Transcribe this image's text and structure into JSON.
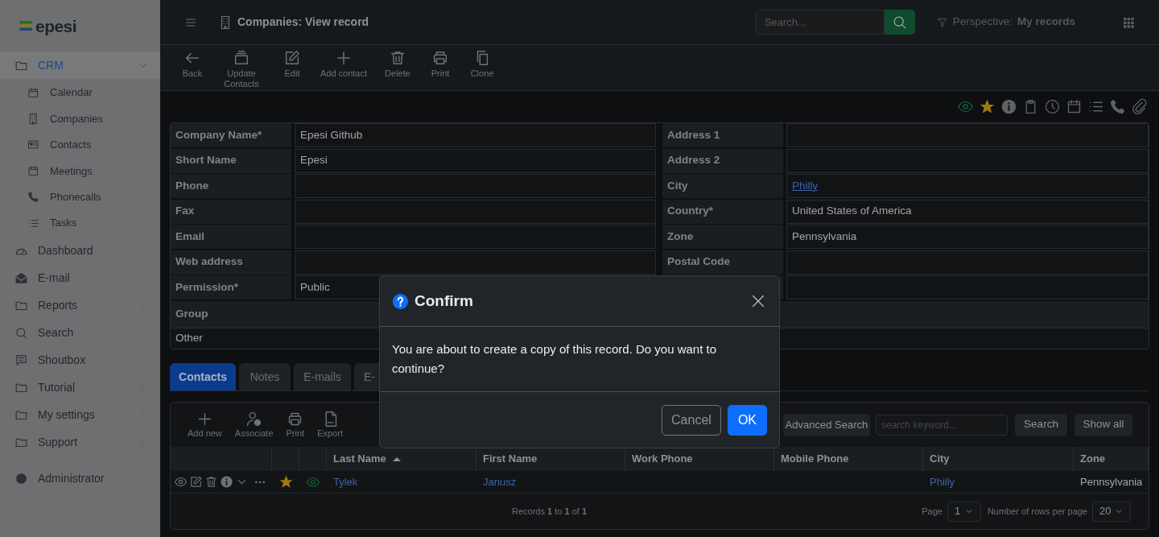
{
  "logo": {
    "text": "epesi"
  },
  "sidebar": {
    "items": [
      {
        "label": "CRM",
        "selected": true,
        "expanded": true,
        "children": [
          {
            "label": "Calendar"
          },
          {
            "label": "Companies"
          },
          {
            "label": "Contacts"
          },
          {
            "label": "Meetings"
          },
          {
            "label": "Phonecalls"
          },
          {
            "label": "Tasks"
          }
        ]
      },
      {
        "label": "Dashboard",
        "selected": false
      },
      {
        "label": "E-mail",
        "selected": false
      },
      {
        "label": "Reports",
        "selected": false,
        "expanded": false
      },
      {
        "label": "Search",
        "selected": false
      },
      {
        "label": "Shoutbox",
        "selected": false
      },
      {
        "label": "Tutorial",
        "selected": false,
        "expanded": false
      },
      {
        "label": "My settings",
        "selected": false,
        "expanded": false
      },
      {
        "label": "Support",
        "selected": false,
        "expanded": false
      }
    ],
    "bottom_items": [
      {
        "label": "Administrator",
        "selected": false
      }
    ]
  },
  "header": {
    "title": "Companies: View record",
    "search": {
      "placeholder": "Search..."
    },
    "perspective": {
      "label": "Perspective:",
      "value": "My records"
    }
  },
  "toolbar": [
    {
      "label": "Back"
    },
    {
      "label": "Update Contacts"
    },
    {
      "label": "Edit"
    },
    {
      "label": "Add contact"
    },
    {
      "label": "Delete"
    },
    {
      "label": "Print"
    },
    {
      "label": "Clone"
    }
  ],
  "record_icons": {
    "watched": true,
    "favorite": true
  },
  "form": {
    "left": [
      {
        "label": "Company Name*",
        "value": "Epesi Github"
      },
      {
        "label": "Short Name",
        "value": "Epesi"
      },
      {
        "label": "Phone"
      },
      {
        "label": "Fax"
      },
      {
        "label": "Email"
      },
      {
        "label": "Web address"
      },
      {
        "label": "Permission*",
        "value": "Public"
      }
    ],
    "right": [
      {
        "label": "Address 1"
      },
      {
        "label": "Address 2"
      },
      {
        "label": "City",
        "value": "Philly",
        "link": true
      },
      {
        "label": "Country*",
        "value": "United States of America"
      },
      {
        "label": "Zone",
        "value": "Pennsylvania"
      },
      {
        "label": "Postal Code"
      }
    ],
    "group": {
      "label": "Group",
      "value": "Other"
    }
  },
  "tabs": [
    {
      "label": "Contacts",
      "selected": true
    },
    {
      "label": "Notes",
      "selected": false
    },
    {
      "label": "E-mails",
      "selected": false
    },
    {
      "label": "E-",
      "selected": false
    }
  ],
  "contacts_table": {
    "toolbar": [
      {
        "label": "Add new"
      },
      {
        "label": "Associate"
      },
      {
        "label": "Print"
      },
      {
        "label": "Export"
      }
    ],
    "advanced_search": "Advanced Search",
    "search": {
      "placeholder": "search keyword..."
    },
    "buttons": [
      "Search",
      "Show all"
    ],
    "columns": [
      {
        "label": "Last Name",
        "sort_ascending": true
      },
      {
        "label": "First Name"
      },
      {
        "label": "Work Phone"
      },
      {
        "label": "Mobile Phone"
      },
      {
        "label": "City"
      },
      {
        "label": "Zone"
      }
    ],
    "rows": [
      {
        "favorite": true,
        "watched": true,
        "cells": [
          {
            "text": "Tylek",
            "link": true
          },
          {
            "text": "Janusz",
            "link": true
          },
          {},
          {},
          {
            "text": "Philly",
            "link": true
          },
          {
            "text": "Pennsylvania"
          }
        ]
      }
    ],
    "records": "Records **1** to **1** of **1**",
    "page": {
      "label": "Page",
      "value": "1"
    },
    "rows_per_page": {
      "label": "Number of rows per page",
      "value": "20"
    }
  },
  "dialog": {
    "title": "Confirm",
    "message": "You are about to create a copy of this record. Do you want to continue?",
    "buttons": [
      {
        "label": "Cancel",
        "kind": "secondary"
      },
      {
        "label": "OK",
        "kind": "primary"
      }
    ]
  }
}
